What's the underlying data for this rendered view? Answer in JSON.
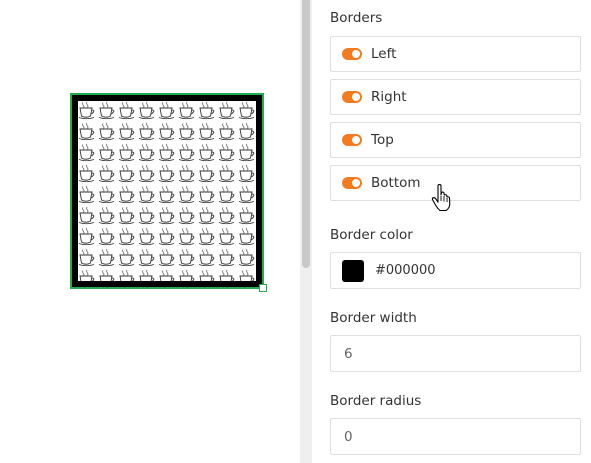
{
  "canvas": {
    "image": {
      "pattern": "coffee-cup-pattern",
      "border_color": "#000000",
      "selection_color": "#1fae4b"
    }
  },
  "panel": {
    "borders": {
      "title": "Borders",
      "toggles": [
        {
          "label": "Left",
          "on": true
        },
        {
          "label": "Right",
          "on": true
        },
        {
          "label": "Top",
          "on": true
        },
        {
          "label": "Bottom",
          "on": true
        }
      ],
      "toggle_color": "#f47b20"
    },
    "border_color": {
      "label": "Border color",
      "value": "#000000"
    },
    "border_width": {
      "label": "Border width",
      "value": "6"
    },
    "border_radius": {
      "label": "Border radius",
      "value": "0"
    }
  },
  "cursor": {
    "icon": "hand-pointer-icon"
  }
}
